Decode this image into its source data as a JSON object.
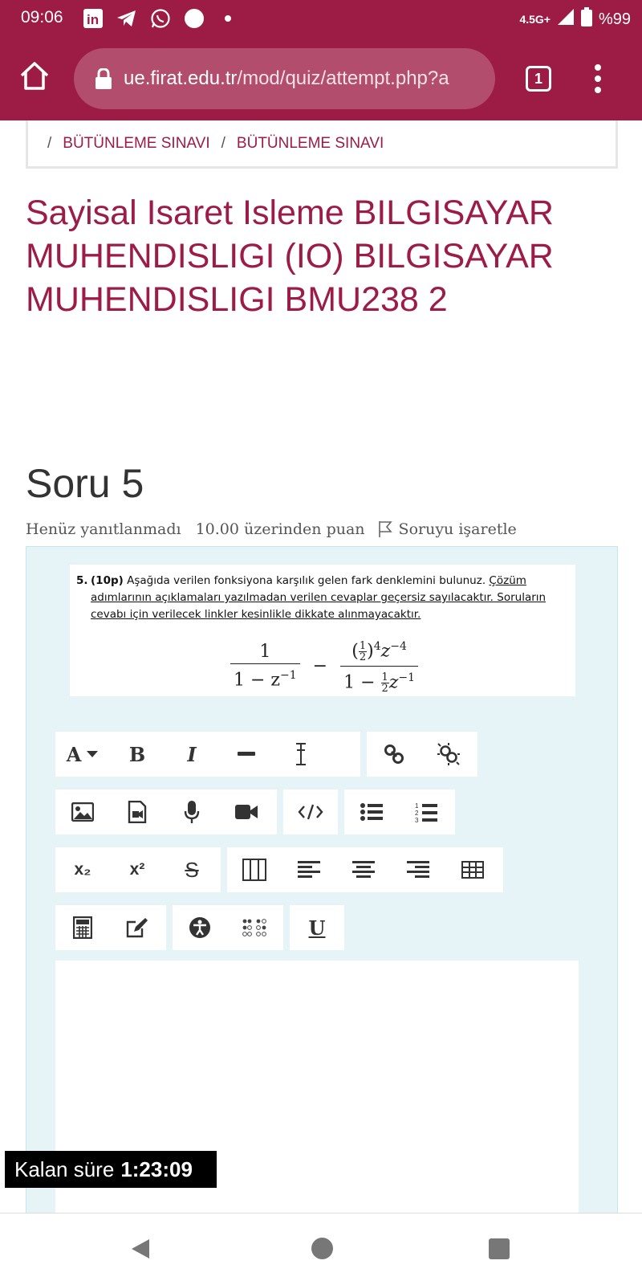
{
  "status_bar": {
    "time": "09:06",
    "network": "4.5G+",
    "battery": "%99",
    "icons": [
      "linkedin-icon",
      "telegram-icon",
      "whatsapp-icon",
      "circle-notification-icon",
      "dot-icon",
      "signal-icon",
      "battery-icon"
    ]
  },
  "browser": {
    "url_host": "ue.firat.edu.tr",
    "url_path": "/mod/quiz/attempt.php?a",
    "tab_count": "1"
  },
  "breadcrumb": {
    "items": [
      "BÜTÜNLEME SINAVI",
      "BÜTÜNLEME SINAVI"
    ],
    "separator": "/"
  },
  "page": {
    "title": "Sayisal Isaret Isleme BILGISAYAR MUHENDISLIGI (IO) BILGISAYAR MUHENDISLIGI BMU238 2"
  },
  "question": {
    "heading": "Soru 5",
    "status": "Henüz yanıtlanmadı",
    "points": "10.00 üzerinden puan",
    "flag_label": "Soruyu işaretle",
    "number": "5.",
    "points_tag": "(10p)",
    "text": "Aşağıda verilen fonksiyona karşılık gelen fark denklemini bulunuz.",
    "warning": "Çözüm adımlarının açıklamaları yazılmadan verilen cevaplar geçersiz sayılacaktır. Soruların cevabı için verilecek linkler kesinlikle dikkate alınmayacaktır.",
    "formula": {
      "left_num": "1",
      "left_den": "1 − z",
      "left_den_exp": "−1",
      "op": "−",
      "right_num_exp1": "4",
      "right_num_z": "z",
      "right_num_exp2": "−4",
      "half_num": "1",
      "half_den": "2",
      "right_den_prefix": "1 −",
      "right_den_z": "z",
      "right_den_exp": "−1"
    }
  },
  "editor": {
    "toolbar_row1": {
      "font": "A",
      "bold": "B",
      "italic": "I"
    },
    "underline": "U",
    "subscript": "x₂",
    "superscript": "x²",
    "strike": "S"
  },
  "timer": {
    "label": "Kalan süre",
    "value": "1:23:09"
  },
  "colors": {
    "brand": "#9c1c45",
    "question_bg": "#e7f4f7"
  }
}
